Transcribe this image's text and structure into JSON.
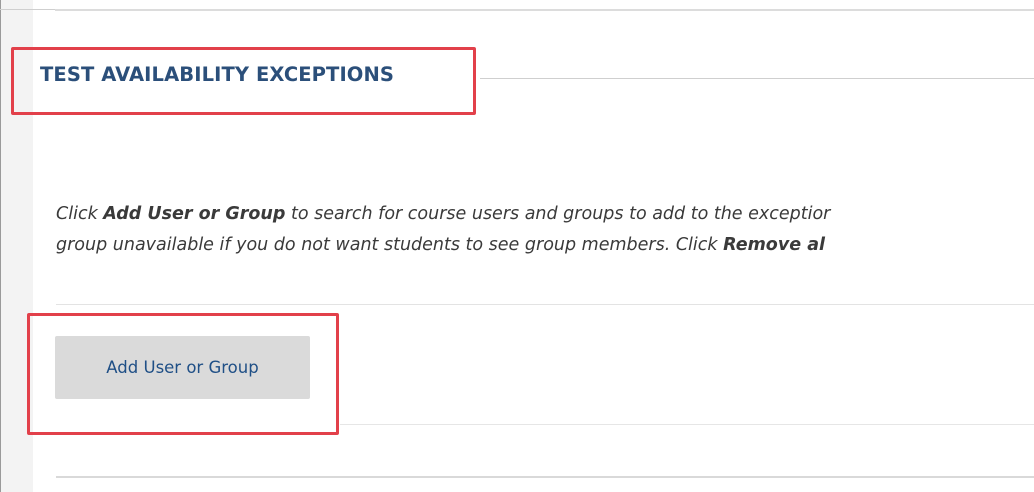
{
  "section": {
    "title": "TEST AVAILABILITY EXCEPTIONS"
  },
  "instructions": {
    "line1_prefix": "Click ",
    "line1_bold": "Add User or Group",
    "line1_suffix": " to search for course users and groups to add to the exceptior",
    "line2_prefix": "group unavailable if you do not want students to see group members. Click ",
    "line2_bold": "Remove al"
  },
  "actions": {
    "add_user_or_group_label": "Add User or Group"
  },
  "colors": {
    "heading": "#2b4f7a",
    "highlight": "#e2404a",
    "button_bg": "#dadada",
    "button_text": "#1f4f86"
  }
}
